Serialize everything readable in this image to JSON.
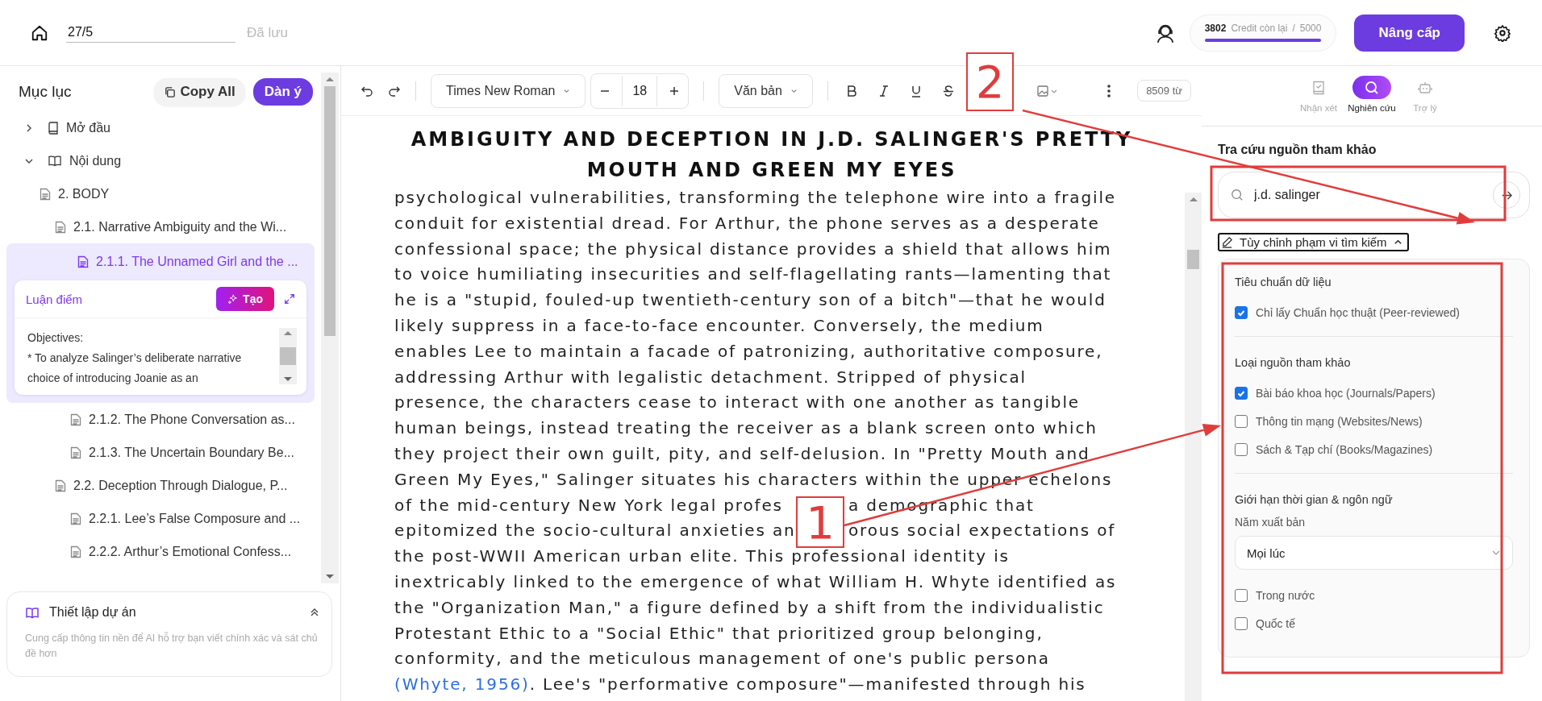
{
  "topbar": {
    "doc_name": "27/5",
    "save_status": "Đã lưu",
    "credits": {
      "remaining": "3802",
      "label": "Credit còn lại",
      "separator": "/",
      "total": "5000",
      "level": 1
    },
    "upgrade": "Nâng cấp"
  },
  "sidebar": {
    "title": "Mục lục",
    "copy_all": "Copy All",
    "outline_button": "Dàn ý",
    "tree": [
      {
        "kind": "group",
        "label": "Mở đầu",
        "expanded": false
      },
      {
        "kind": "group",
        "label": "Nội dung",
        "expanded": true,
        "children": [
          {
            "kind": "section",
            "label": "2. BODY",
            "selected": false,
            "children": [
              {
                "kind": "section",
                "label": "2.1. Narrative Ambiguity and the Wi...",
                "selected": false,
                "children": [
                  {
                    "kind": "section",
                    "label": "2.1.1. The Unnamed Girl and the ...",
                    "selected": true,
                    "note": {
                      "label": "Luận điểm",
                      "button": "Tạo",
                      "text": "Objectives:\n* To analyze Salinger’s deliberate narrative\nchoice of introducing Joanie as an"
                    }
                  },
                  {
                    "kind": "section",
                    "label": "2.1.2. The Phone Conversation as...",
                    "selected": false
                  },
                  {
                    "kind": "section",
                    "label": "2.1.3. The Uncertain Boundary Be...",
                    "selected": false
                  }
                ]
              },
              {
                "kind": "section",
                "label": "2.2. Deception Through Dialogue, P...",
                "selected": false,
                "children": [
                  {
                    "kind": "section",
                    "label": "2.2.1. Lee’s False Composure and ...",
                    "selected": false
                  },
                  {
                    "kind": "section",
                    "label": "2.2.2. Arthur’s Emotional Confess...",
                    "selected": false
                  }
                ]
              }
            ]
          }
        ]
      }
    ],
    "project_setup": {
      "title": "Thiết lập dự án",
      "description": "Cung cấp thông tin nền để AI hỗ trợ bạn viết chính xác và sát chủ đề hơn"
    }
  },
  "toolbar": {
    "font": "Times New Roman",
    "font_size": "18",
    "style": "Văn bản",
    "word_count": "8509 từ"
  },
  "document": {
    "title_lines": [
      "AMBIGUITY AND DECEPTION IN J.D. SALINGER'S PRETTY",
      "MOUTH AND GREEN MY EYES"
    ],
    "lines": [
      [
        {
          "kind": "text",
          "text": "psychological vulnerabilities, transforming the telephone wire into a fragile"
        }
      ],
      [
        {
          "kind": "text",
          "text": "conduit for existential dread. For Arthur, the phone serves as a desperate"
        }
      ],
      [
        {
          "kind": "text",
          "text": "confessional space; the physical distance provides a shield that allows him"
        }
      ],
      [
        {
          "kind": "text",
          "text": "to voice humiliating insecurities and self-flagellating rants—lamenting that"
        }
      ],
      [
        {
          "kind": "text",
          "text": "he is a \"stupid, fouled-up twentieth-century son of a bitch\"—that he would"
        }
      ],
      [
        {
          "kind": "text",
          "text": "likely suppress in a face-to-face encounter. Conversely, the medium"
        }
      ],
      [
        {
          "kind": "text",
          "text": "enables Lee to maintain a facade of patronizing, authoritative composure,"
        }
      ],
      [
        {
          "kind": "text",
          "text": "addressing Arthur with legalistic detachment. Stripped of physical"
        }
      ],
      [
        {
          "kind": "text",
          "text": "presence, the characters cease to interact with one another as tangible"
        }
      ],
      [
        {
          "kind": "text",
          "text": "human beings, instead treating the receiver as a blank screen onto which"
        }
      ],
      [
        {
          "kind": "text",
          "text": "they project their own guilt, pity, and self-delusion. In \"Pretty Mouth and"
        }
      ],
      [
        {
          "kind": "text",
          "text": "Green My Eyes,\" Salinger situates his characters within the upper echelons"
        }
      ],
      [
        {
          "kind": "text",
          "text": "of the mid-century New York legal profes"
        },
        {
          "kind": "gap"
        },
        {
          "kind": "text",
          "text": "a demographic that"
        }
      ],
      [
        {
          "kind": "text",
          "text": "epitomized the socio-cultural anxieties an"
        },
        {
          "kind": "gap"
        },
        {
          "kind": "text",
          "text": "orous social expectations of"
        }
      ],
      [
        {
          "kind": "text",
          "text": "the post-WWII American urban elite. This professional identity is"
        }
      ],
      [
        {
          "kind": "text",
          "text": "inextricably linked to the emergence of what William H. Whyte identified as"
        }
      ],
      [
        {
          "kind": "text",
          "text": "the \"Organization Man,\" a figure defined by a shift from the individualistic"
        }
      ],
      [
        {
          "kind": "text",
          "text": "Protestant Ethic to a \"Social Ethic\" that prioritized group belonging,"
        }
      ],
      [
        {
          "kind": "text",
          "text": "conformity, and the meticulous management of one's public persona"
        }
      ],
      [
        {
          "kind": "link",
          "text": "(Whyte, 1956)"
        },
        {
          "kind": "text",
          "text": ". Lee's \"performative composure\"—manifested through his"
        }
      ]
    ]
  },
  "right_panel": {
    "tabs": [
      {
        "kind": "review",
        "label": "Nhận xét",
        "selected": false
      },
      {
        "kind": "research",
        "label": "Nghiên cứu",
        "selected": true
      },
      {
        "kind": "assistant",
        "label": "Trợ lý",
        "selected": false
      }
    ],
    "heading": "Tra cứu nguồn tham khảo",
    "search": {
      "value": "j.d. salinger"
    },
    "scope_toggle": {
      "label": "Tùy chỉnh phạm vi tìm kiếm",
      "expanded": true
    },
    "filters": [
      {
        "heading": "Tiêu chuẩn dữ liệu",
        "items": [
          {
            "kind": "checkbox",
            "label": "Chỉ lấy Chuẩn học thuật (Peer-reviewed)",
            "checked": true
          }
        ]
      },
      {
        "heading": "Loại nguồn tham khảo",
        "items": [
          {
            "kind": "checkbox",
            "label": "Bài báo khoa học (Journals/Papers)",
            "checked": true
          },
          {
            "kind": "checkbox",
            "label": "Thông tin mạng (Websites/News)",
            "checked": false
          },
          {
            "kind": "checkbox",
            "label": "Sách & Tạp chí (Books/Magazines)",
            "checked": false
          }
        ]
      },
      {
        "heading": "Giới hạn thời gian & ngôn ngữ",
        "items": [
          {
            "kind": "select",
            "label": "Năm xuất bản",
            "value": "Mọi lúc"
          },
          {
            "kind": "checkbox",
            "label": "Trong nước",
            "checked": false
          },
          {
            "kind": "checkbox",
            "label": "Quốc tế",
            "checked": false
          }
        ]
      }
    ]
  },
  "annotations": [
    {
      "number": "2"
    },
    {
      "number": "1"
    }
  ]
}
